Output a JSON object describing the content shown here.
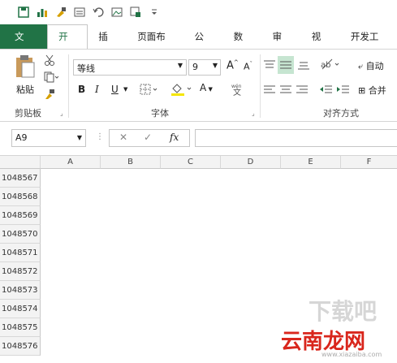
{
  "tabs": [
    {
      "label": "文件"
    },
    {
      "label": "开始"
    },
    {
      "label": "插入"
    },
    {
      "label": "页面布局"
    },
    {
      "label": "公式"
    },
    {
      "label": "数据"
    },
    {
      "label": "审阅"
    },
    {
      "label": "视图"
    },
    {
      "label": "开发工具"
    }
  ],
  "clipboard": {
    "paste_label": "粘贴",
    "group_label": "剪贴板"
  },
  "font": {
    "name": "等线",
    "size": "9",
    "group_label": "字体",
    "bold": "B",
    "italic": "I",
    "underline": "U",
    "grow": "A",
    "shrink": "A",
    "font_color": "A"
  },
  "alignment": {
    "group_label": "对齐方式",
    "wrap_label": "自动",
    "merge_label": "合并"
  },
  "formula_bar": {
    "name_box": "A9",
    "fx": "fx",
    "cancel": "✕",
    "confirm": "✓"
  },
  "columns": [
    "A",
    "B",
    "C",
    "D",
    "E",
    "F"
  ],
  "rows": [
    "1048567",
    "1048568",
    "1048569",
    "1048570",
    "1048571",
    "1048572",
    "1048573",
    "1048574",
    "1048575",
    "1048576"
  ],
  "watermark": {
    "text_top": "下载吧",
    "text_main": "云南龙网",
    "text_url": "www.xiazaiba.com"
  },
  "colors": {
    "accent": "#217346",
    "watermark_red": "#d9261c"
  }
}
